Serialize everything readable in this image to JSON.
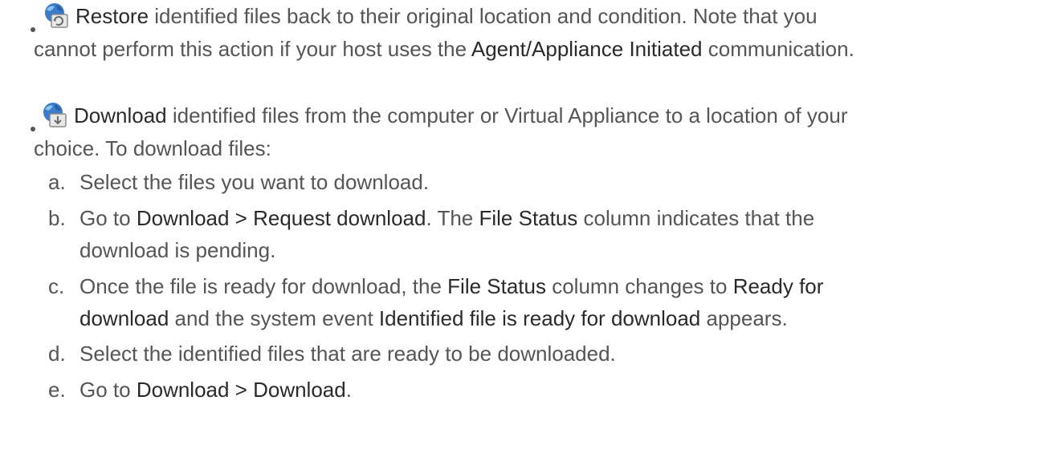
{
  "restore": {
    "icon": "restore-icon",
    "label": "Restore",
    "text1": " identified files back to their original location and condition. Note that you",
    "text2a": "cannot perform this action if your host uses the ",
    "bold": "Agent/Appliance Initiated",
    "text2b": " communication."
  },
  "download": {
    "icon": "download-icon",
    "label": "Download",
    "text1": " identified files from the computer or Virtual Appliance to a location of your",
    "text2": "choice. To download files:",
    "steps": [
      {
        "letter": "a.",
        "line1": "Select the files you want to download."
      },
      {
        "letter": "b.",
        "pre": "Go to ",
        "b1": "Download > Request download",
        "mid": ". The ",
        "b2": "File Status",
        "post": " column indicates that the",
        "line2": "download is pending."
      },
      {
        "letter": "c.",
        "pre": "Once the file is ready for download, the ",
        "b1": "File Status",
        "mid": " column changes to ",
        "b2": "Ready for",
        "b3": "download",
        "mid2": " and the system event ",
        "b4": "Identified file is ready for download",
        "post": " appears."
      },
      {
        "letter": "d.",
        "line1": "Select the identified files that are ready to be downloaded."
      },
      {
        "letter": "e.",
        "pre": "Go to ",
        "b1": "Download > Download",
        "post": "."
      }
    ]
  }
}
